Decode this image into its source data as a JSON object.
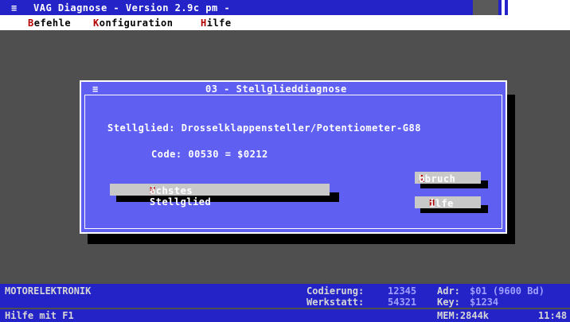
{
  "titlebar": {
    "sysmenu": "≡",
    "title": "VAG Diagnose - Version 2.9c pm -"
  },
  "menu": [
    {
      "hot": "B",
      "rest": "efehle"
    },
    {
      "hot": "K",
      "rest": "onfiguration"
    },
    {
      "hot": "H",
      "rest": "ilfe"
    }
  ],
  "dialog": {
    "sysmenu": "≡",
    "title": "03 - Stellglieddiagnose",
    "stellglied": "Stellglied: Drosselklappensteller/Potentiometer-G88",
    "code": "Code: 00530 = $0212",
    "next_button": {
      "hot": "N",
      "rest": "ächstes Stellglied"
    },
    "abort_button": {
      "hot": "A",
      "rest": "bbruch"
    },
    "help_button": {
      "hot": "H",
      "rest": "ilfe"
    }
  },
  "status": {
    "module": "MOTORELEKTRONIK",
    "codierung_label": "Codierung:",
    "codierung_value": "12345",
    "werkstatt_label": "Werkstatt:",
    "werkstatt_value": "54321",
    "adr_label": "Adr:",
    "adr_value": "$01 (9600 Bd)",
    "key_label": "Key:",
    "key_value": "$1234"
  },
  "bottombar": {
    "help_hint": "Hilfe mit F1",
    "mem": "MEM:2844k",
    "time": "11:48"
  },
  "colors": {
    "desktop": "#4f4f4f",
    "titlebar": "#2323c8",
    "dialog": "#5f5ff2",
    "button": "#c8c8c8",
    "hotkey": "#b40000"
  }
}
